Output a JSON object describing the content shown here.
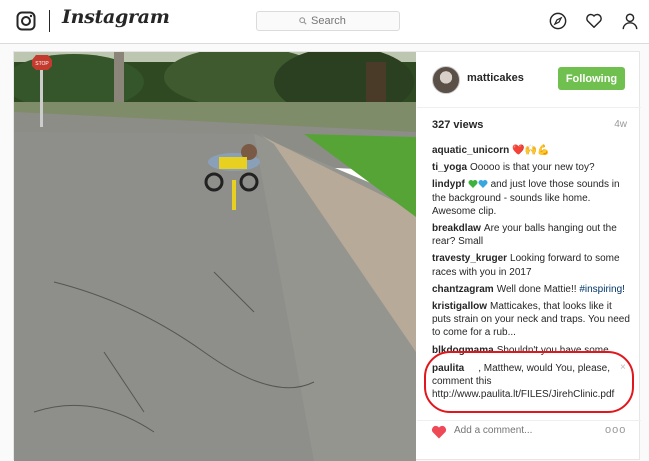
{
  "header": {
    "brand": "Instagram",
    "search_placeholder": "Search"
  },
  "post": {
    "username": "matticakes",
    "follow_label": "Following",
    "views": "327 views",
    "age": "4w",
    "comments": [
      {
        "user": "aquatic_unicorn",
        "text": "❤️🙌💪"
      },
      {
        "user": "ti_yoga",
        "text": "Ooooo is that your new toy?"
      },
      {
        "user": "lindypf",
        "text": "and just love those sounds in the background - sounds like home. Awesome clip."
      },
      {
        "user": "breakdlaw",
        "text": "Are your balls hanging out the rear? Small"
      },
      {
        "user": "travesty_kruger",
        "text": "Looking forward to some races with you in 2017"
      },
      {
        "user": "chantzagram",
        "text": "Well done Mattie!!",
        "hashtag": "#inspiring!"
      },
      {
        "user": "kristigallow",
        "text": "Matticakes, that looks like it puts strain on your neck and traps. You need to come for a rub..."
      },
      {
        "user": "blkdogmama",
        "text": "Shouldn't you have some protection on those toes?!"
      }
    ],
    "highlighted_comment": {
      "user": "paulita",
      "text": ", Matthew, would You, please, comment this http://www.paulita.lt/FILES/JirehClinic.pdf",
      "close": "×"
    },
    "add_comment_placeholder": "Add a comment...",
    "more": "ooo"
  },
  "colors": {
    "follow_green": "#70c050",
    "highlight_red": "#e2161d",
    "heart_red": "#ed4956"
  },
  "icons": [
    "instagram-logo-icon",
    "search-icon",
    "compass-icon",
    "heart-icon",
    "profile-icon"
  ]
}
